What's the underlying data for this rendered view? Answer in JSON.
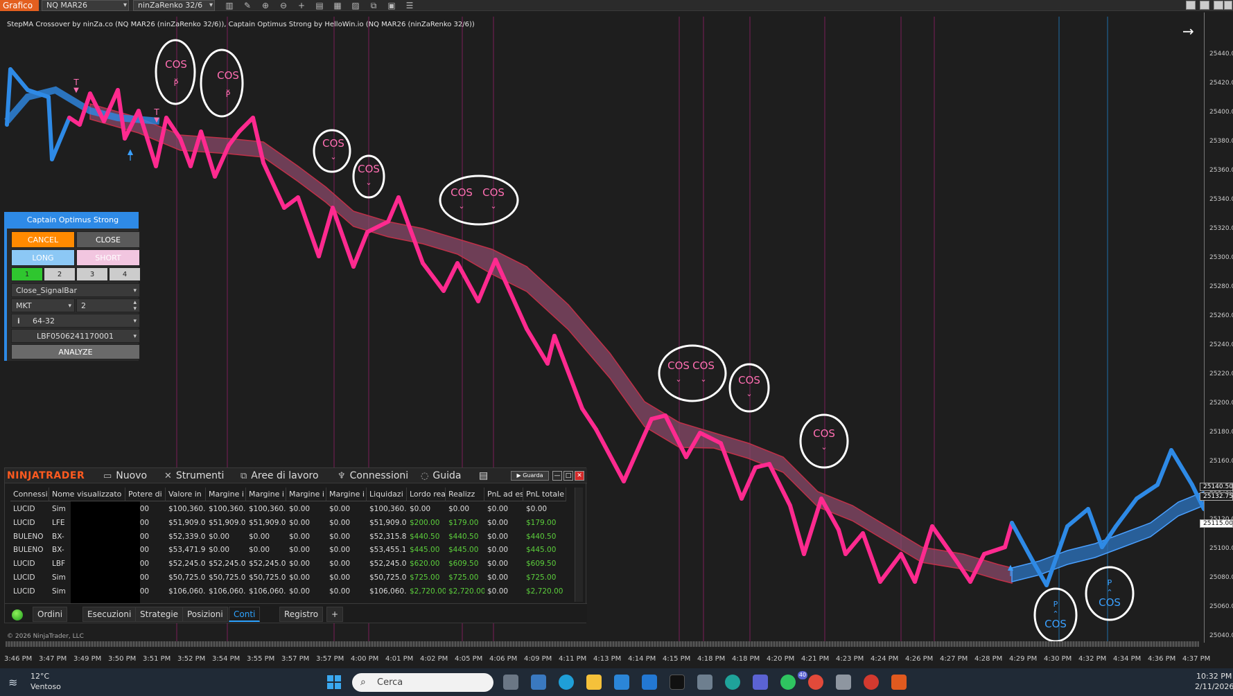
{
  "topbar": {
    "tab_label": "Grafico",
    "instrument": "NQ MAR26",
    "bar_type": "ninZaRenko 32/6"
  },
  "chart": {
    "indicator_title": "StepMA Crossover by ninZa.co (NQ MAR26 (ninZaRenko 32/6)), Captain Optimus Strong by HelloWin.io (NQ MAR26 (ninZaRenko 32/6))",
    "price_labels": [
      "25440.00",
      "25420.00",
      "25400.00",
      "25380.00",
      "25360.00",
      "25340.00",
      "25320.00",
      "25300.00",
      "25280.00",
      "25260.00",
      "25240.00",
      "25220.00",
      "25200.00",
      "25180.00",
      "25160.00",
      "25140.00",
      "25120.00",
      "25100.00",
      "25080.00",
      "25060.00",
      "25040.00"
    ],
    "price_tags": [
      "25140.50",
      "25132.75",
      "25115.00"
    ],
    "time_labels": [
      "3:46 PM",
      "3:47 PM",
      "3:49 PM",
      "3:50 PM",
      "3:51 PM",
      "3:52 PM",
      "3:54 PM",
      "3:55 PM",
      "3:57 PM",
      "3:57 PM",
      "4:00 PM",
      "4:01 PM",
      "4:02 PM",
      "4:05 PM",
      "4:06 PM",
      "4:09 PM",
      "4:11 PM",
      "4:13 PM",
      "4:14 PM",
      "4:15 PM",
      "4:18 PM",
      "4:18 PM",
      "4:20 PM",
      "4:21 PM",
      "4:23 PM",
      "4:24 PM",
      "4:26 PM",
      "4:27 PM",
      "4:28 PM",
      "4:29 PM",
      "4:30 PM",
      "4:32 PM",
      "4:34 PM",
      "4:36 PM",
      "4:37 PM"
    ],
    "signal_cos": "COS",
    "signal_p": "P",
    "signal_t": "T",
    "copyright": "© 2026 NinjaTrader, LLC",
    "colors": {
      "bear": "#ff2a8f",
      "bull": "#2e8ae6",
      "band": "#8a4a6a"
    }
  },
  "order_panel": {
    "title": "Captain Optimus Strong",
    "cancel": "CANCEL",
    "close": "CLOSE",
    "long": "LONG",
    "short": "SHORT",
    "quantities": [
      "1",
      "2",
      "3",
      "4"
    ],
    "signal_mode": "Close_SignalBar",
    "order_type": "MKT",
    "order_qty": "2",
    "info_icon": "i",
    "atm": "64-32",
    "account": "LBF0506241170001",
    "analyze": "ANALYZE"
  },
  "nt": {
    "logo": "NINJATRADER",
    "menu": [
      "Nuovo",
      "Strumenti",
      "Aree di lavoro",
      "Connessioni",
      "Guida"
    ],
    "guarda": "Guarda",
    "columns": [
      "Connessi",
      "Nome visualizzato",
      "Potere di",
      "Valore in",
      "Margine i",
      "Margine i",
      "Margine i",
      "Margine i",
      "Liquidazi",
      "Lordo rea",
      "Realizz",
      "PnL ad es",
      "PnL totale"
    ],
    "rows": [
      [
        "LUCID",
        "Sim",
        "$0.00",
        "$100,360.",
        "$100,360.",
        "$100,360.",
        "$0.00",
        "$0.00",
        "$100,360.",
        "$0.00",
        "$0.00",
        "$0.00",
        "$0.00"
      ],
      [
        "LUCID",
        "LFE",
        "$0.00",
        "$51,909.0",
        "$51,909.0",
        "$51,909.0",
        "$0.00",
        "$0.00",
        "$51,909.0",
        "$200.00",
        "$179.00",
        "$0.00",
        "$179.00"
      ],
      [
        "BULENO",
        "BX-",
        "$0.00",
        "$52,339.0",
        "$0.00",
        "$0.00",
        "$0.00",
        "$0.00",
        "$52,315.8",
        "$440.50",
        "$440.50",
        "$0.00",
        "$440.50"
      ],
      [
        "BULENO",
        "BX-",
        "$0.00",
        "$53,471.9",
        "$0.00",
        "$0.00",
        "$0.00",
        "$0.00",
        "$53,455.1",
        "$445.00",
        "$445.00",
        "$0.00",
        "$445.00"
      ],
      [
        "LUCID",
        "LBF",
        "$0.00",
        "$52,245.0",
        "$52,245.0",
        "$52,245.0",
        "$0.00",
        "$0.00",
        "$52,245.0",
        "$620.00",
        "$609.50",
        "$0.00",
        "$609.50"
      ],
      [
        "LUCID",
        "Sim",
        "$0.00",
        "$50,725.0",
        "$50,725.0",
        "$50,725.0",
        "$0.00",
        "$0.00",
        "$50,725.0",
        "$725.00",
        "$725.00",
        "$0.00",
        "$725.00"
      ],
      [
        "LUCID",
        "Sim",
        "$0.00",
        "$106,060.",
        "$106,060.",
        "$106,060.",
        "$0.00",
        "$0.00",
        "$106,060.",
        "$2,720.00",
        "$2,720.00",
        "$0.00",
        "$2,720.00"
      ]
    ],
    "tabs": [
      "Ordini",
      "Esecuzioni",
      "Strategie",
      "Posizioni",
      "Conti",
      "Registro",
      "+"
    ]
  },
  "taskbar": {
    "temp": "12°C",
    "weather": "Ventoso",
    "search_placeholder": "Cerca",
    "badge": "40",
    "time": "10:32 PM",
    "date": "2/11/2026"
  }
}
